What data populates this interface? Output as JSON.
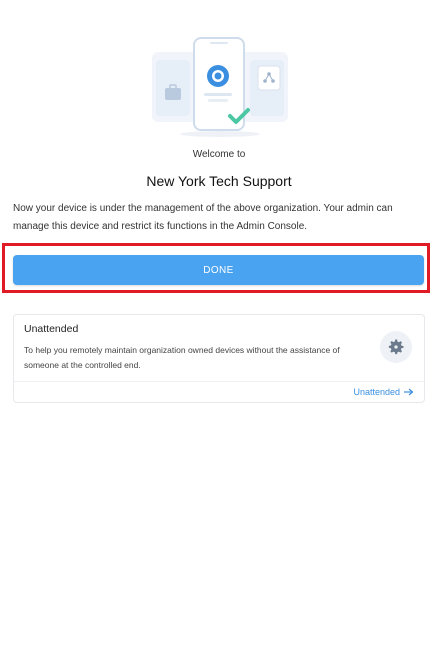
{
  "header": {
    "welcome": "Welcome to",
    "org_name": "New York Tech Support"
  },
  "description": "Now your device is under the management of the above organization. Your admin can manage this device and restrict its functions in the Admin Console.",
  "done_button": {
    "label": "DONE"
  },
  "unattended_card": {
    "title": "Unattended",
    "description": "To help you remotely maintain organization owned devices without the assistance of someone at the controlled end.",
    "link_label": "Unattended",
    "icon": "gear-icon"
  },
  "colors": {
    "accent": "#4aa3f0",
    "link": "#3b8fe0",
    "highlight": "#e01b24"
  }
}
